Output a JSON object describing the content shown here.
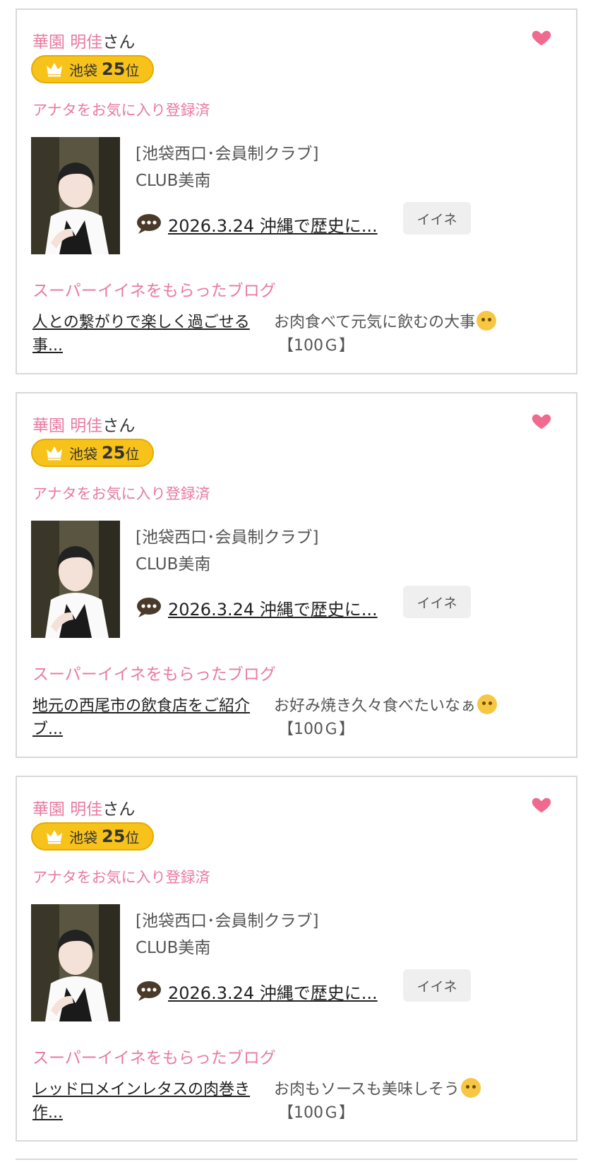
{
  "colors": {
    "accent_pink": "#e97aa0",
    "rank_gold": "#f7c21a",
    "heart": "#f06a8f"
  },
  "cards": [
    {
      "name": "華園 明佳",
      "suffix": "さん",
      "rank": {
        "area": "池袋",
        "number": "25",
        "unit": "位"
      },
      "favorite_status": "アナタをお気に入り登録済",
      "category": "[池袋西口･会員制クラブ]",
      "club": "CLUB美南",
      "latest_post": "2026.3.24 沖縄で歴史に...",
      "iine_label": "イイネ",
      "super_heading": "スーパーイイネをもらったブログ",
      "blog_title": "人との繋がりで楽しく過ごせる事...",
      "comment": "お肉食べて元気に飲むの大事",
      "points": "【100Ｇ】",
      "emoji": "pleading-face-icon"
    },
    {
      "name": "華園 明佳",
      "suffix": "さん",
      "rank": {
        "area": "池袋",
        "number": "25",
        "unit": "位"
      },
      "favorite_status": "アナタをお気に入り登録済",
      "category": "[池袋西口･会員制クラブ]",
      "club": "CLUB美南",
      "latest_post": "2026.3.24 沖縄で歴史に...",
      "iine_label": "イイネ",
      "super_heading": "スーパーイイネをもらったブログ",
      "blog_title": "地元の西尾市の飲食店をご紹介ブ...",
      "comment": "お好み焼き久々食べたいなぁ",
      "points": "【100Ｇ】",
      "emoji": "relieved-face-icon"
    },
    {
      "name": "華園 明佳",
      "suffix": "さん",
      "rank": {
        "area": "池袋",
        "number": "25",
        "unit": "位"
      },
      "favorite_status": "アナタをお気に入り登録済",
      "category": "[池袋西口･会員制クラブ]",
      "club": "CLUB美南",
      "latest_post": "2026.3.24 沖縄で歴史に...",
      "iine_label": "イイネ",
      "super_heading": "スーパーイイネをもらったブログ",
      "blog_title": "レッドロメインレタスの肉巻き作...",
      "comment": "お肉もソースも美味しそう",
      "points": "【100Ｇ】",
      "emoji": "relieved-face-icon"
    }
  ]
}
